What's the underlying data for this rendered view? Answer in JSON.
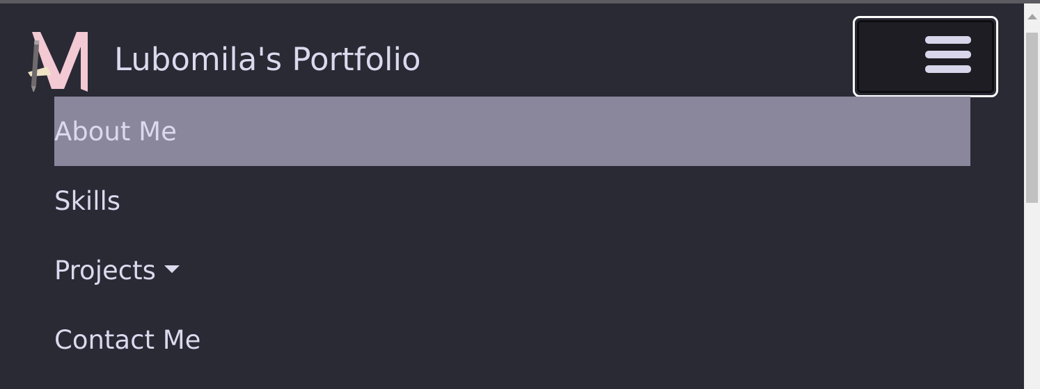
{
  "brand": {
    "title": "Lubomila's Portfolio",
    "logo_icon": "monogram-m-pencil-icon"
  },
  "toggler": {
    "icon": "hamburger-menu-icon"
  },
  "nav": {
    "items": [
      {
        "label": "About Me",
        "active": true
      },
      {
        "label": "Skills",
        "active": false
      },
      {
        "label": "Projects",
        "active": false,
        "dropdown": true
      },
      {
        "label": "Contact Me",
        "active": false
      }
    ]
  },
  "colors": {
    "background": "#2a2a35",
    "text": "#dcd9ee",
    "active_item": "#8a869c",
    "logo_pink": "#f3c9d4",
    "toggler_border": "#ffffff"
  }
}
